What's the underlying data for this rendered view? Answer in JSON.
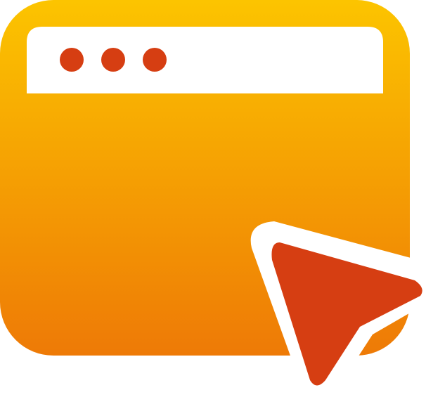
{
  "icon": {
    "name": "browser-window-click-icon",
    "window_icon": "browser-window-icon",
    "cursor_icon": "mouse-pointer-arrow-icon",
    "window_controls": [
      "window-dot-icon",
      "window-dot-icon",
      "window-dot-icon"
    ]
  },
  "colors": {
    "window_gradient_top": "#FCC400",
    "window_gradient_bottom": "#EE7A06",
    "title_bar": "#FFFFFF",
    "dots": "#D63E12",
    "cursor_fill": "#D63E12",
    "cursor_outline": "#FFFFFF",
    "background": "#FFFFFF"
  }
}
